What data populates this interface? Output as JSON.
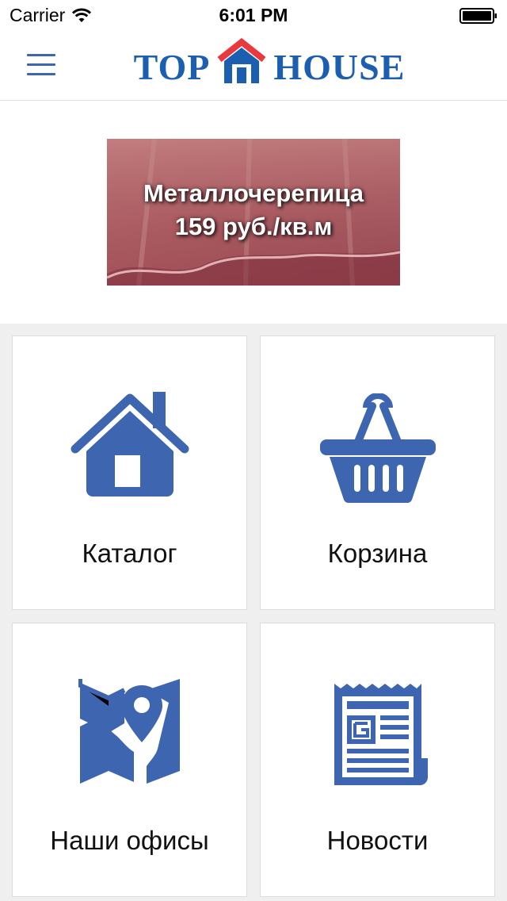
{
  "status_bar": {
    "carrier": "Carrier",
    "time": "6:01 PM"
  },
  "header": {
    "logo_left": "TOP",
    "logo_right": "HOUSE",
    "menu_icon": "hamburger-menu-icon"
  },
  "banner": {
    "line1": "Металлочерепица",
    "line2": "159 руб./кв.м"
  },
  "tiles": [
    {
      "label": "Каталог",
      "icon": "house-icon"
    },
    {
      "label": "Корзина",
      "icon": "basket-icon"
    },
    {
      "label": "Наши офисы",
      "icon": "map-pin-icon"
    },
    {
      "label": "Новости",
      "icon": "newspaper-icon"
    }
  ],
  "colors": {
    "brand_blue": "#1c5fb0",
    "icon_blue": "#3e66b0",
    "logo_red": "#e8393f",
    "grid_background": "#efefef"
  }
}
